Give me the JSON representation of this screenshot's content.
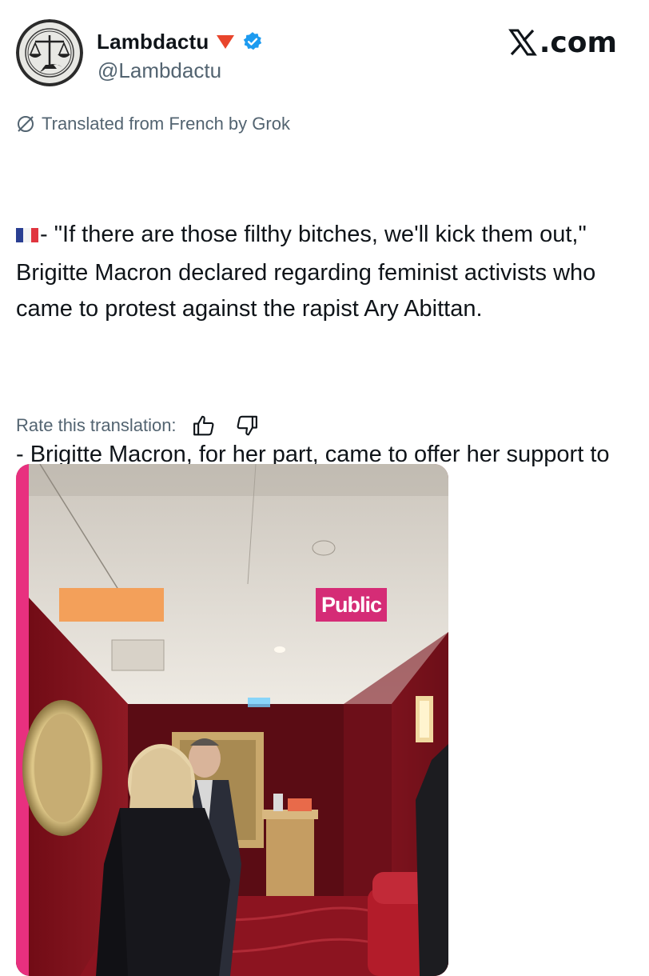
{
  "author": {
    "display_name": "Lambdactu",
    "handle": "@Lambdactu",
    "avatar_icon": "scales-of-justice-logo",
    "badges": [
      "red-triangle-icon",
      "verified-check-icon"
    ],
    "verified_color": "#1d9bf0"
  },
  "brand": {
    "text": ".com",
    "logo_icon": "x-logo-icon"
  },
  "translation": {
    "notice": "Translated from French by Grok",
    "icon": "grok-icon",
    "rate_label": "Rate this translation:",
    "rate_up_icon": "thumbs-up-icon",
    "rate_down_icon": "thumbs-down-icon"
  },
  "tweet": {
    "flag_icon": "france-flag-icon",
    "paragraph_1": "- \"If there are those filthy bitches, we'll kick them out,\" Brigitte Macron declared regarding feminist activists who came to protest against the rapist Ary Abittan.",
    "paragraph_2": "- Brigitte Macron, for her part, came to offer her support to the rapist."
  },
  "media": {
    "overlay_badge": "Public",
    "badge_color": "#d52c76",
    "accent_bar_color": "#e8307f"
  }
}
